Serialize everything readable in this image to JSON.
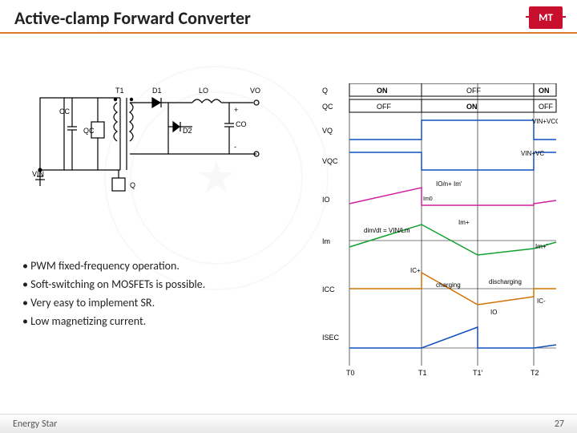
{
  "header": {
    "title": "Active-clamp Forward Converter",
    "logo_text": "MT"
  },
  "circuit": {
    "labels": {
      "VIN": "VIN",
      "CC_left": "CC",
      "QC": "QC",
      "T1": "T1",
      "D1": "D1",
      "D2": "D2",
      "LO": "LO",
      "VO": "VO",
      "CO": "CO",
      "Q": "Q",
      "plus": "+",
      "minus": "-"
    }
  },
  "bullets": [
    "PWM fixed-frequency operation.",
    "Soft-switching on MOSFETs is possible.",
    "Very easy to implement SR.",
    "Low magnetizing current."
  ],
  "waveforms": {
    "rows": {
      "Q": "Q",
      "QC": "QC",
      "VQ": "VQ",
      "VQC": "VQC",
      "IO": "IO",
      "Im": "Im",
      "ICC": "ICC",
      "ISEC": "ISEC"
    },
    "states": {
      "ON": "ON",
      "OFF": "OFF"
    },
    "annotations": {
      "vin_vcc": "VIN+VCC",
      "vin_vc": "VIN+VC",
      "io_label": "IO/n+ Im'",
      "im0": "Im0",
      "dim_dt": "dim/dt = VIN/Lm",
      "im_plus": "Im+",
      "im_plus2": "Im+'",
      "ic_plus": "IC+",
      "ic_minus": "IC-",
      "charging": "charging",
      "discharging": "discharging",
      "io_small": "IO"
    },
    "timeline": {
      "T0": "T0",
      "T1": "T1",
      "T1p": "T1'",
      "T2": "T2"
    }
  },
  "footer": {
    "left": "Energy Star",
    "page": "27"
  }
}
